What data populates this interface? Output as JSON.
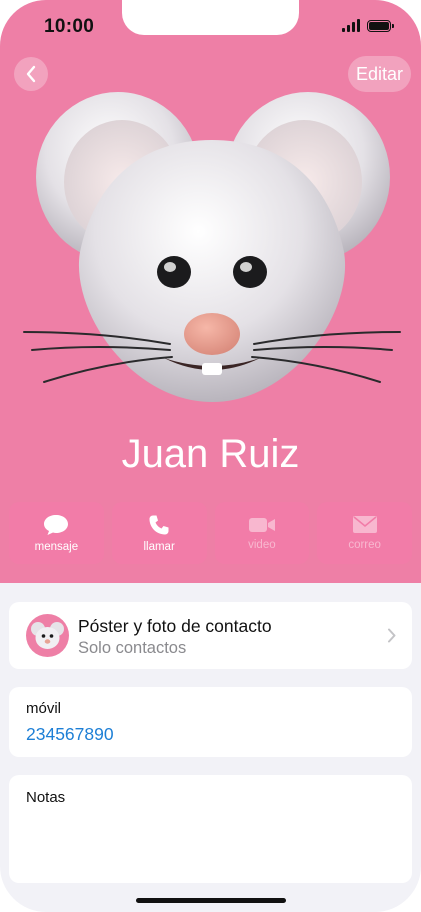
{
  "status_bar": {
    "time": "10:00"
  },
  "header": {
    "edit_label": "Editar"
  },
  "contact": {
    "name": "Juan Ruiz"
  },
  "actions": [
    {
      "label": "mensaje",
      "icon": "message-bubble-icon",
      "enabled": true
    },
    {
      "label": "llamar",
      "icon": "phone-icon",
      "enabled": true
    },
    {
      "label": "video",
      "icon": "video-camera-icon",
      "enabled": false
    },
    {
      "label": "correo",
      "icon": "mail-envelope-icon",
      "enabled": false
    }
  ],
  "poster": {
    "title": "Póster y foto de contacto",
    "subtitle": "Solo contactos"
  },
  "phone": {
    "label": "móvil",
    "number": "234567890"
  },
  "notes": {
    "label": "Notas"
  },
  "colors": {
    "hero_background": "#ee7fa6",
    "link_blue": "#1d7fd6"
  }
}
